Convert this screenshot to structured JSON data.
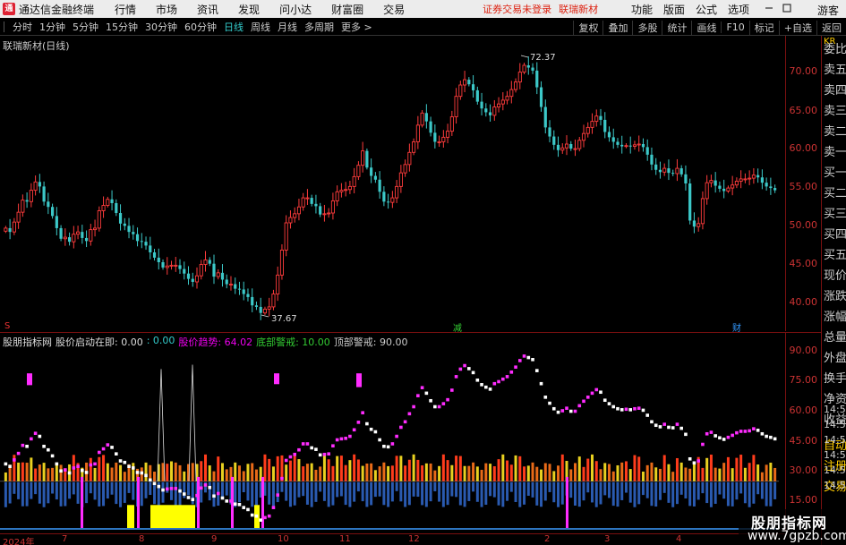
{
  "titlebar": {
    "app_title": "通达信金融终端",
    "menu": [
      "行情",
      "市场",
      "资讯",
      "发现",
      "问小达",
      "财富圈",
      "交易"
    ],
    "warning": "证券交易未登录",
    "stock_link": "联瑞新材",
    "right_menu": [
      "功能",
      "版面",
      "公式",
      "选项"
    ],
    "guest": "游客"
  },
  "toolbar": {
    "periods": [
      "分时",
      "1分钟",
      "5分钟",
      "15分钟",
      "30分钟",
      "60分钟",
      "日线",
      "周线",
      "月线",
      "多周期",
      "更多 >"
    ],
    "active_period": "日线",
    "tools": [
      "复权",
      "叠加",
      "多股",
      "统计",
      "画线",
      "F10",
      "标记",
      "+自选",
      "返回"
    ]
  },
  "main_chart": {
    "label": "联瑞新材(日线)",
    "max_label": "72.37",
    "min_label": "37.67",
    "price_ticks": [
      "70.00",
      "65.00",
      "60.00",
      "55.00",
      "50.00",
      "45.00",
      "40.00"
    ],
    "markers": [
      "S",
      "减",
      "财"
    ]
  },
  "indicator": {
    "name": "股朋指标网",
    "f1_label": "股价启动在即: 0.00",
    "f1_value": ": 0.00",
    "f2": "股价趋势: 64.02",
    "f3": "底部警戒: 10.00",
    "f4": "顶部警戒: 90.00",
    "ticks": [
      "90.00",
      "75.00",
      "60.00",
      "45.00",
      "30.00",
      "15.00"
    ]
  },
  "date_axis": {
    "labels": [
      "2024年",
      "7",
      "8",
      "9",
      "10",
      "11",
      "12",
      "2",
      "3",
      "4"
    ]
  },
  "quote_panel": {
    "head": "KR",
    "rows": [
      "委比",
      "卖五",
      "卖四",
      "卖三",
      "卖二",
      "卖一",
      "买一",
      "买二",
      "买三",
      "买四",
      "买五",
      "现价",
      "涨跌",
      "涨幅",
      "总量",
      "外盘",
      "换手",
      "净资",
      "收益",
      "自动",
      "注册",
      "交易"
    ],
    "times": [
      "14:5",
      "14:5",
      "14:5",
      "14:5",
      "14:5",
      "14:5"
    ]
  },
  "watermark": {
    "line1": "股朋指标网",
    "line2": "www.7gpzb.com"
  },
  "chart_data": {
    "type": "candlestick",
    "y_range_price": [
      36,
      75
    ],
    "y_range_indicator": [
      10,
      95
    ],
    "closes": [
      49.6,
      49.1,
      50.4,
      51.7,
      53.3,
      53.1,
      54.6,
      55.7,
      55.1,
      53.1,
      52.4,
      51.2,
      49.6,
      48.2,
      48.4,
      47.8,
      48.8,
      49.1,
      48.3,
      47.9,
      49.4,
      49.6,
      51.9,
      52.6,
      53.4,
      52.9,
      51.6,
      50.2,
      49.9,
      49.1,
      48.8,
      47.9,
      47.8,
      47.3,
      46.4,
      45.7,
      45.1,
      44.4,
      44.6,
      44.7,
      44.7,
      44.2,
      43.6,
      42.9,
      42.5,
      43.3,
      44.8,
      45.4,
      44.9,
      43.2,
      43.7,
      42.8,
      42.2,
      42.2,
      41.6,
      41.5,
      40.9,
      40.5,
      39.4,
      39.2,
      38.4,
      38.9,
      39.2,
      40.9,
      43.4,
      46.7,
      50.3,
      51.0,
      51.5,
      52.4,
      53.6,
      53.6,
      52.8,
      52.5,
      51.4,
      51.5,
      51.6,
      53.2,
      54.4,
      54.6,
      54.7,
      55.1,
      56.4,
      57.9,
      59.8,
      57.6,
      56.5,
      56.0,
      54.4,
      53.1,
      53.0,
      53.6,
      55.1,
      56.9,
      58.0,
      59.6,
      61.0,
      63.2,
      64.8,
      63.7,
      62.2,
      61.0,
      61.0,
      61.6,
      62.4,
      64.3,
      67.0,
      68.5,
      69.2,
      68.6,
      67.8,
      66.3,
      65.4,
      64.9,
      64.5,
      65.6,
      66.0,
      66.5,
      67.0,
      67.9,
      68.9,
      70.2,
      71.1,
      70.8,
      70.4,
      68.2,
      65.6,
      62.9,
      61.7,
      60.6,
      59.9,
      60.2,
      60.7,
      60.1,
      60.1,
      61.2,
      62.1,
      62.9,
      63.7,
      64.4,
      63.9,
      62.3,
      61.6,
      61.0,
      60.6,
      60.4,
      60.5,
      60.4,
      60.6,
      60.7,
      60.3,
      59.3,
      58.0,
      57.3,
      57.0,
      57.5,
      56.9,
      56.8,
      57.5,
      56.7,
      55.5,
      50.6,
      49.8,
      50.2,
      53.5,
      55.6,
      55.9,
      55.2,
      54.8,
      54.5,
      54.9,
      55.3,
      55.8,
      56.1,
      56.1,
      56.2,
      56.6,
      56.3,
      55.6,
      55.1,
      54.9,
      54.6
    ]
  }
}
